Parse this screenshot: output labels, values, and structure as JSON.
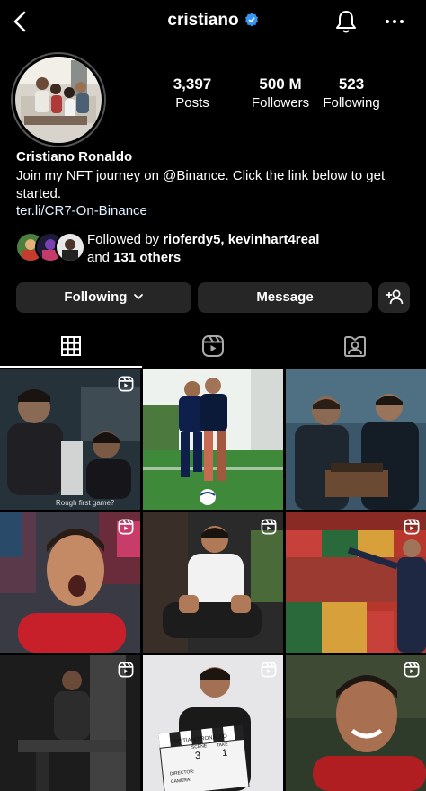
{
  "header": {
    "username": "cristiano",
    "back_icon": "chevron-left-icon",
    "bell_icon": "bell-icon",
    "more_icon": "more-horizontal-icon",
    "verified_color": "#3797f0"
  },
  "profile": {
    "stats": [
      {
        "value": "3,397",
        "label": "Posts"
      },
      {
        "value": "500 M",
        "label": "Followers"
      },
      {
        "value": "523",
        "label": "Following"
      }
    ],
    "name": "Cristiano Ronaldo",
    "bio": "Join my NFT journey on @Binance. Click the link below to get started.",
    "link": "ter.li/CR7-On-Binance",
    "followed_by_prefix": "Followed by ",
    "followed_by_names": "rioferdy5, kevinhart4real",
    "followed_by_and": "and ",
    "followed_by_others": "131 others"
  },
  "buttons": {
    "following": "Following",
    "message": "Message",
    "add_user_icon": "add-user-icon"
  },
  "tabs": [
    {
      "name": "grid",
      "icon": "grid-icon",
      "active": true
    },
    {
      "name": "reels",
      "icon": "reels-icon",
      "active": false
    },
    {
      "name": "tagged",
      "icon": "tagged-icon",
      "active": false
    }
  ],
  "posts": [
    {
      "caption": "Rough first game?",
      "reel": true
    },
    {
      "caption": "",
      "reel": false
    },
    {
      "caption": "",
      "reel": false
    },
    {
      "caption": "",
      "reel": true
    },
    {
      "caption": "",
      "reel": true
    },
    {
      "caption": "",
      "reel": true
    },
    {
      "caption": "",
      "reel": true
    },
    {
      "caption": "",
      "reel": true
    },
    {
      "caption": "",
      "reel": true
    }
  ],
  "clapper": {
    "line1": "CRISTIANO RONALDO",
    "scene_label": "SCENE",
    "take_label": "TAKE",
    "scene": "3",
    "take": "1",
    "director_label": "DIRECTOR:",
    "camera_label": "CAMERA:"
  },
  "colors": {
    "background": "#000000",
    "button_bg": "#262626",
    "link": "#e0f1ff"
  }
}
